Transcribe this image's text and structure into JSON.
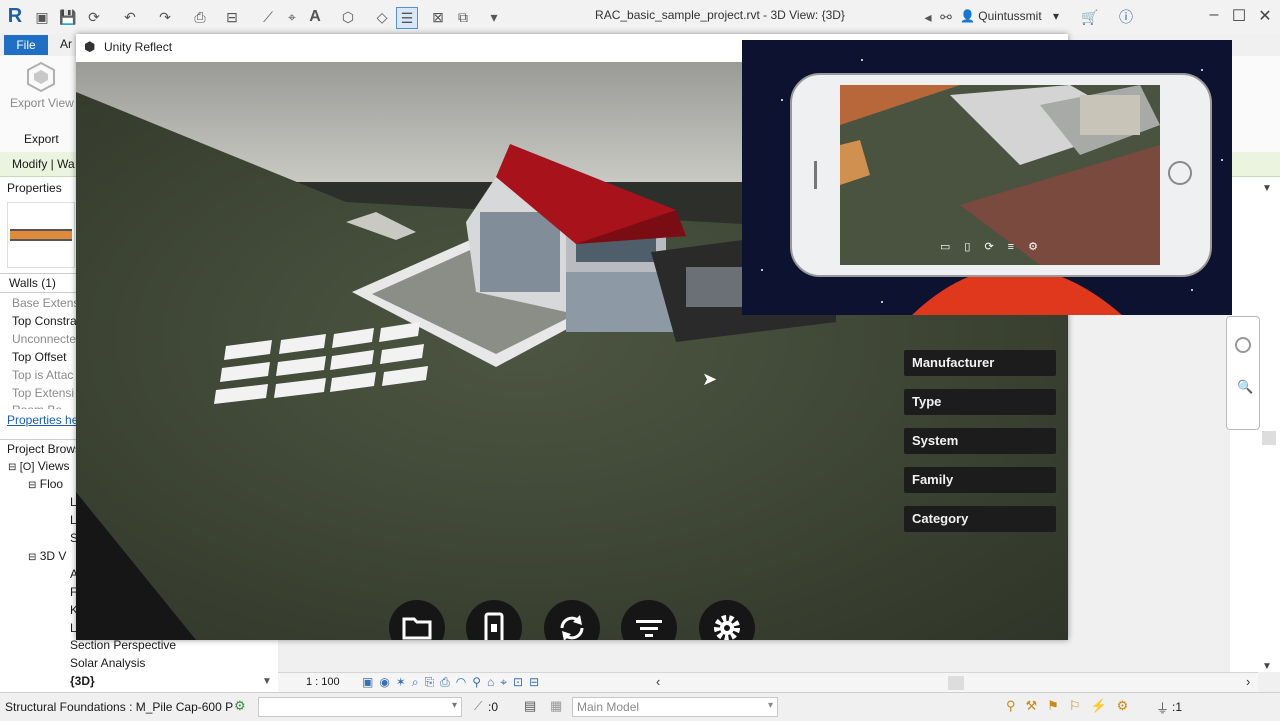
{
  "titlebar": {
    "app_logo": "R",
    "document_title": "RAC_basic_sample_project.rvt - 3D View: {3D}",
    "user_name": "Quintussmit"
  },
  "ribbon": {
    "file_tab": "File",
    "partial_tab": "Ar",
    "export_view_label": "Export View",
    "export_panel_label": "Export",
    "modify_context": "Modify | Wa"
  },
  "properties": {
    "header": "Properties",
    "selector": "Walls (1)",
    "rows": [
      {
        "label": "Base Extens",
        "muted": true
      },
      {
        "label": "Top Constra",
        "muted": false
      },
      {
        "label": "Unconnecte",
        "muted": true
      },
      {
        "label": "Top Offset",
        "muted": false
      },
      {
        "label": "Top is Attac",
        "muted": true
      },
      {
        "label": "Top Extensi",
        "muted": true
      },
      {
        "label": "Room Bo",
        "muted": true
      }
    ],
    "help_link": "Properties he"
  },
  "project_browser": {
    "header": "Project Brows",
    "views_label": "Views",
    "floor_label": "Floo",
    "floor_children": [
      "L",
      "L",
      "S"
    ],
    "three_d_label": "3D V",
    "three_d_children": [
      "A",
      "F",
      "K",
      "L"
    ],
    "lower_items": [
      "Section Perspective",
      "Solar Analysis",
      "{3D}"
    ]
  },
  "unity_reflect": {
    "title": "Unity Reflect",
    "filters": [
      "Manufacturer",
      "Type",
      "System",
      "Family",
      "Category"
    ],
    "toolbar_buttons": [
      "folder",
      "phone",
      "sync",
      "filter",
      "settings"
    ]
  },
  "view_control": {
    "scale": "1 : 100"
  },
  "statusbar": {
    "selection_text": "Structural Foundations : M_Pile Cap-600 P",
    "count": ":0",
    "model_select": "Main Model",
    "filter_count": ":1"
  },
  "colors": {
    "file_tab_blue": "#1f6fc5",
    "modify_bar_green": "#eaf4df",
    "roof_red": "#a8121a",
    "filter_button_bg": "#1c1c1c",
    "grass": "#3d4534"
  }
}
